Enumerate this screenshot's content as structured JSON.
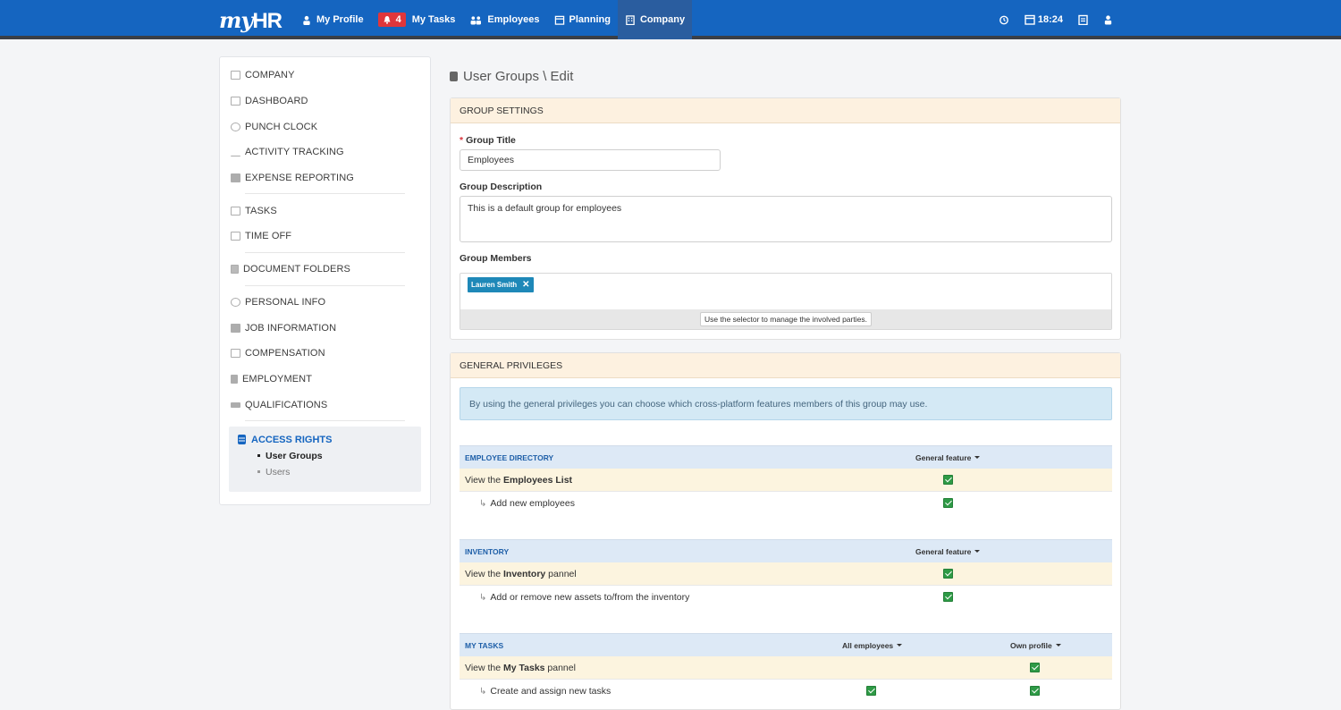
{
  "app": {
    "logo_my": "my",
    "logo_hr": "HR"
  },
  "nav": {
    "my_profile": "My Profile",
    "tasks_badge": "4",
    "my_tasks": "My Tasks",
    "employees": "Employees",
    "planning": "Planning",
    "company": "Company"
  },
  "tools": {
    "time": "18:24"
  },
  "sidebar": {
    "company": "COMPANY",
    "dashboard": "DASHBOARD",
    "punch_clock": "PUNCH CLOCK",
    "activity_tracking": "ACTIVITY TRACKING",
    "expense_reporting": "EXPENSE REPORTING",
    "tasks": "TASKS",
    "time_off": "TIME OFF",
    "document_folders": "DOCUMENT FOLDERS",
    "personal_info": "PERSONAL INFO",
    "job_information": "JOB INFORMATION",
    "compensation": "COMPENSATION",
    "employment": "EMPLOYMENT",
    "qualifications": "QUALIFICATIONS",
    "access_rights": "ACCESS RIGHTS",
    "user_groups": "User Groups",
    "users": "Users"
  },
  "page": {
    "title": "User Groups \\ Edit"
  },
  "group_settings": {
    "header": "GROUP SETTINGS",
    "title_label": "Group Title",
    "title_value": "Employees",
    "desc_label": "Group Description",
    "desc_value": "This is a default group for employees",
    "members_label": "Group Members",
    "member_tag": "Lauren Smith",
    "members_hint": "Use the selector to manage the involved parties."
  },
  "general_privileges": {
    "header": "GENERAL PRIVILEGES",
    "info": "By using the general privileges you can choose which cross-platform features members of this group may use.",
    "sections": [
      {
        "title": "EMPLOYEE DIRECTORY",
        "col1": "General feature",
        "row_main_pre": "View the ",
        "row_main_bold": "Employees List",
        "row_main_post": "",
        "row_sub": "Add new employees"
      },
      {
        "title": "INVENTORY",
        "col1": "General feature",
        "row_main_pre": "View the ",
        "row_main_bold": "Inventory",
        "row_main_post": " pannel",
        "row_sub": "Add or remove new assets to/from the inventory"
      },
      {
        "title": "MY TASKS",
        "col1": "All employees",
        "col2": "Own profile",
        "row_main_pre": "View the ",
        "row_main_bold": "My Tasks",
        "row_main_post": " pannel",
        "row_sub": "Create and assign new tasks"
      }
    ]
  },
  "colors": {
    "topbar": "#1565c0",
    "accent": "#1565c0",
    "check": "#2e9a46",
    "badge": "#e0363b"
  }
}
